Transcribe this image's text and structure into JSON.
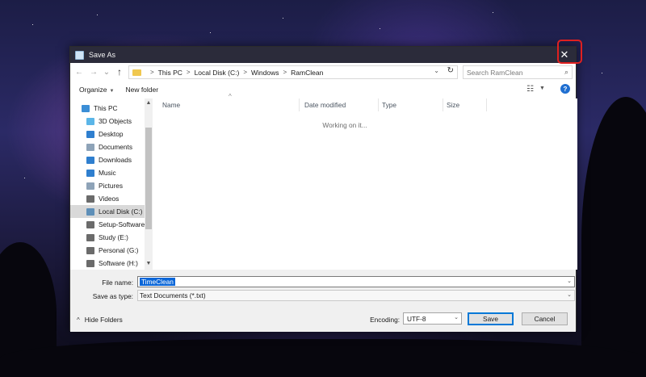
{
  "window": {
    "title": "Save As",
    "close_glyph": "✕"
  },
  "address": {
    "back_glyph": "←",
    "forward_glyph": "→",
    "recent_glyph": "⌄",
    "up_glyph": "↑",
    "crumbs": [
      "This PC",
      "Local Disk (C:)",
      "Windows",
      "RamClean"
    ],
    "separator": ">",
    "dropdown_glyph": "⌄",
    "refresh_glyph": "↻"
  },
  "search": {
    "placeholder": "Search RamClean",
    "icon_glyph": "⌕"
  },
  "toolbar": {
    "organize_label": "Organize",
    "organize_caret": "▼",
    "new_folder_label": "New folder",
    "view_glyph": "☷",
    "view_caret": "▼",
    "help_glyph": "?"
  },
  "nav": {
    "items": [
      {
        "label": "This PC",
        "icon": "this-pc-icon",
        "color": "#3b8ed6"
      },
      {
        "label": "3D Objects",
        "icon": "3d-objects-icon",
        "color": "#5bb6e8"
      },
      {
        "label": "Desktop",
        "icon": "desktop-icon",
        "color": "#2f7fcf"
      },
      {
        "label": "Documents",
        "icon": "documents-icon",
        "color": "#8ea3b8"
      },
      {
        "label": "Downloads",
        "icon": "downloads-icon",
        "color": "#2f7fcf"
      },
      {
        "label": "Music",
        "icon": "music-icon",
        "color": "#2f7fcf"
      },
      {
        "label": "Pictures",
        "icon": "pictures-icon",
        "color": "#8ea3b8"
      },
      {
        "label": "Videos",
        "icon": "videos-icon",
        "color": "#6b6b6b"
      },
      {
        "label": "Local Disk (C:)",
        "icon": "local-disk-icon",
        "color": "#5e8fb8"
      },
      {
        "label": "Setup-Software (",
        "icon": "drive-icon",
        "color": "#6b6b6b"
      },
      {
        "label": "Study (E:)",
        "icon": "drive-icon",
        "color": "#6b6b6b"
      },
      {
        "label": "Personal (G:)",
        "icon": "drive-icon",
        "color": "#6b6b6b"
      },
      {
        "label": "Software (H:)",
        "icon": "drive-icon",
        "color": "#6b6b6b"
      }
    ],
    "selected_index": 8,
    "scroll_up_glyph": "▲",
    "scroll_down_glyph": "▼"
  },
  "files": {
    "columns": [
      "Name",
      "Date modified",
      "Type",
      "Size"
    ],
    "sort_glyph": "^",
    "status_text": "Working on it..."
  },
  "form": {
    "file_name_label": "File name:",
    "file_name_value": "TimeClean",
    "save_type_label": "Save as type:",
    "save_type_value": "Text Documents (*.txt)",
    "dropdown_glyph": "⌄",
    "hide_folders_label": "Hide Folders",
    "hide_folders_glyph": "^",
    "encoding_label": "Encoding:",
    "encoding_value": "UTF-8",
    "save_label": "Save",
    "cancel_label": "Cancel"
  },
  "colors": {
    "titlebar": "#2b2b3a",
    "selection": "#0a66d8",
    "highlight_box": "#e02020",
    "accent": "#0078d7"
  }
}
